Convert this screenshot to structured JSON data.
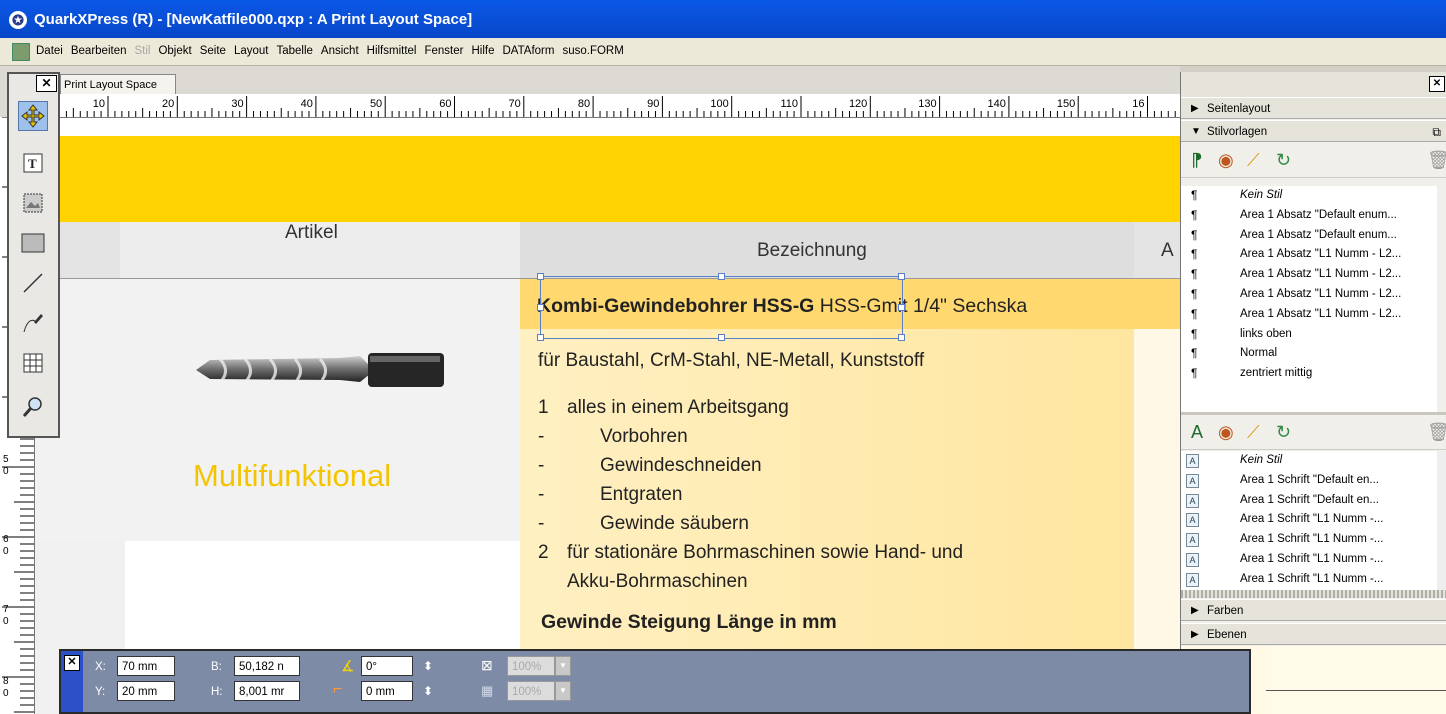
{
  "window": {
    "title": "QuarkXPress (R) - [NewKatfile000.qxp : A Print Layout Space]"
  },
  "menu": [
    "Datei",
    "Bearbeiten",
    "Stil",
    "Objekt",
    "Seite",
    "Layout",
    "Tabelle",
    "Ansicht",
    "Hilfsmittel",
    "Fenster",
    "Hilfe",
    "DATAform",
    "suso.FORM"
  ],
  "menu_disabled": [
    "Stil"
  ],
  "document": {
    "tab_label": "Print Layout Space",
    "ruler_top": [
      "10",
      "20",
      "30",
      "40",
      "50",
      "60",
      "70",
      "80",
      "90",
      "100",
      "110",
      "120",
      "130",
      "140",
      "150",
      "16"
    ],
    "ruler_left": [
      "5",
      "0",
      "6",
      "0",
      "7",
      "0",
      "8",
      "0"
    ]
  },
  "tools": [
    "item-tool",
    "text-tool",
    "picture-tool",
    "rectangle-box-tool",
    "line-tool",
    "bezier-pen-tool",
    "table-tool",
    "zoom-tool"
  ],
  "page": {
    "col_artikel": "Artikel",
    "col_bezeichnung": "Bezeichnung",
    "col_third": "A",
    "product_title_bold": "Kombi-Gewindebohrer HSS-G",
    "product_title_rest": " HSS-Gmit 1/4\" Sechska",
    "materials": "für Baustahl, CrM-Stahl, NE-Metall, Kunststoff",
    "features": [
      {
        "marker": "1",
        "text": "alles in einem Arbeitsgang"
      },
      {
        "marker": "-",
        "text": "Vorbohren"
      },
      {
        "marker": "-",
        "text": "Gewindeschneiden"
      },
      {
        "marker": "-",
        "text": "Entgraten"
      },
      {
        "marker": "-",
        "text": "Gewinde säubern"
      },
      {
        "marker": "2",
        "text": "für stationäre Bohrmaschinen sowie Hand- und"
      },
      {
        "marker": "",
        "text": "Akku-Bohrmaschinen"
      }
    ],
    "table_heading": "Gewinde Steigung Länge in mm",
    "tagline": "Multifunktional",
    "colors": {
      "yellow": "#ffd200",
      "pale_yellow": "#ffe9a0",
      "tagline": "#f5c400"
    }
  },
  "palette": {
    "sections": {
      "seitenlayout": "Seitenlayout",
      "stilvorlagen": "Stilvorlagen",
      "farben": "Farben",
      "ebenen": "Ebenen"
    },
    "paragraph_styles": [
      "Kein Stil",
      "Area 1 Absatz \"Default enum...",
      "Area 1 Absatz \"Default enum...",
      "Area 1 Absatz \"L1 Numm - L2...",
      "Area 1 Absatz \"L1 Numm - L2...",
      "Area 1 Absatz \"L1 Numm - L2...",
      "Area 1 Absatz \"L1 Numm - L2...",
      "links oben",
      "Normal",
      "zentriert mittig"
    ],
    "character_styles": [
      "Kein Stil",
      "Area 1 Schrift \"Default en...",
      "Area 1 Schrift \"Default en...",
      "Area 1 Schrift \"L1 Numm -...",
      "Area 1 Schrift \"L1 Numm -...",
      "Area 1 Schrift \"L1 Numm -...",
      "Area 1 Schrift \"L1 Numm -..."
    ]
  },
  "measurements": {
    "x_label": "X:",
    "x_value": "70 mm",
    "y_label": "Y:",
    "y_value": "20 mm",
    "b_label": "B:",
    "b_value": "50,182 n",
    "h_label": "H:",
    "h_value": "8,001 mr",
    "angle_value": "0°",
    "corner_value": "0 mm",
    "shade_1": "100%",
    "shade_2": "100%"
  }
}
